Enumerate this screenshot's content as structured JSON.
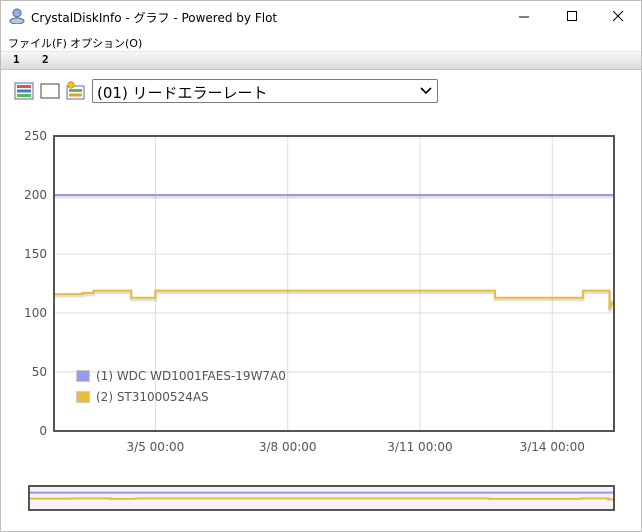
{
  "window": {
    "title": "CrystalDiskInfo - グラフ - Powered by Flot",
    "icon": "crystaldiskinfo-icon"
  },
  "menu": {
    "items": [
      {
        "label": "ファイル(F)"
      },
      {
        "label": "オプション(O)"
      }
    ]
  },
  "tabs": [
    {
      "label": "1"
    },
    {
      "label": "2"
    }
  ],
  "toolbar": {
    "icons": [
      "select-all-icon",
      "clear-icon",
      "plot-settings-icon"
    ],
    "attribute_select": {
      "value": "(01) リードエラーレート"
    }
  },
  "legend": {
    "items": [
      {
        "label": "(1) WDC WD1001FAES-19W7A0"
      },
      {
        "label": "(2) ST31000524AS"
      }
    ]
  },
  "colors": {
    "series1": "#9999ee",
    "series2": "#e8bd3a",
    "grid": "#dddddd",
    "frame": "#545454"
  },
  "chart_data": {
    "type": "line",
    "title": "",
    "xlabel": "",
    "ylabel": "",
    "ylim": [
      0,
      250
    ],
    "yticks": [
      0,
      50,
      100,
      150,
      200,
      250
    ],
    "xlim": [
      2.7,
      15.4
    ],
    "xtick_values": [
      5,
      8,
      11,
      14
    ],
    "xticks": [
      "3/5 00:00",
      "3/8 00:00",
      "3/11 00:00",
      "3/14 00:00"
    ],
    "grid": true,
    "legend_position": "bottom-left",
    "series": [
      {
        "name": "(1) WDC WD1001FAES-19W7A0",
        "points": [
          [
            2.7,
            200
          ],
          [
            15.4,
            200
          ]
        ]
      },
      {
        "name": "(2) ST31000524AS",
        "points": [
          [
            2.7,
            116
          ],
          [
            3.35,
            116
          ],
          [
            3.35,
            117
          ],
          [
            3.6,
            117
          ],
          [
            3.6,
            119
          ],
          [
            4.45,
            119
          ],
          [
            4.45,
            113
          ],
          [
            5.0,
            113
          ],
          [
            5.0,
            119
          ],
          [
            12.7,
            119
          ],
          [
            12.7,
            113
          ],
          [
            14.7,
            113
          ],
          [
            14.7,
            119
          ],
          [
            15.3,
            119
          ],
          [
            15.3,
            103
          ],
          [
            15.35,
            109
          ],
          [
            15.4,
            106
          ]
        ]
      }
    ]
  }
}
